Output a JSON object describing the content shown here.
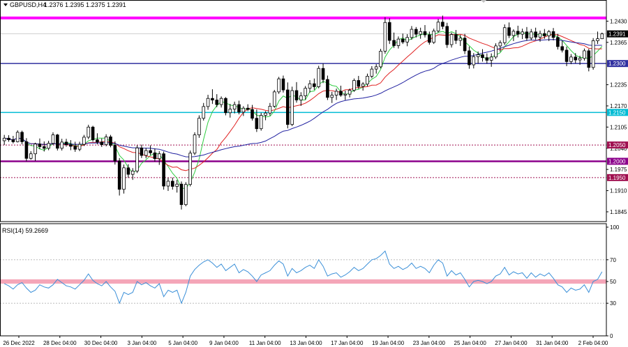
{
  "header": {
    "symbol": "GBPUSD,H4",
    "ohlc": "1.2376 1.2395 1.2375 1.2391",
    "rsi_label": "RSI(14) 59.2669"
  },
  "colors": {
    "bull": "#000000",
    "bear": "#000000",
    "ma_fast": "#2ecc40",
    "ma_mid": "#e02020",
    "ma_slow": "#2020a0",
    "rsi_line": "#3a8fd8",
    "rsi_band": "#f4a6b8"
  },
  "chart_data": [
    {
      "type": "candlestick",
      "ylim": [
        1.1815,
        1.2465
      ],
      "y_ticks": [
        "1.2430",
        "1.2365",
        "1.2235",
        "1.2170",
        "1.2105",
        "1.2040",
        "1.1975",
        "1.1910",
        "1.1845"
      ],
      "x_labels": [
        "26 Dec 2022",
        "28 Dec 04:00",
        "30 Dec 04:00",
        "3 Jan 04:00",
        "5 Jan 04:00",
        "9 Jan 04:00",
        "11 Jan 04:00",
        "13 Jan 04:00",
        "17 Jan 04:00",
        "19 Jan 04:00",
        "23 Jan 04:00",
        "25 Jan 04:00",
        "27 Jan 04:00",
        "31 Jan 04:00",
        "2 Feb 04:00"
      ],
      "current_price": {
        "value": 1.2391,
        "label": "1.2391"
      },
      "levels": [
        {
          "value": 1.244,
          "label": "",
          "color": "#ff00ff",
          "style": "solid",
          "width": 4
        },
        {
          "value": 1.23,
          "label": "1.2300",
          "color": "#3030a0",
          "style": "solid",
          "width": 1.5
        },
        {
          "value": 1.215,
          "label": "1.2150",
          "color": "#00bcd4",
          "style": "solid",
          "width": 1.5
        },
        {
          "value": 1.205,
          "label": "1.2050",
          "color": "#a01050",
          "style": "dotted",
          "width": 1
        },
        {
          "value": 1.2,
          "label": "1.2000",
          "color": "#8b008b",
          "style": "solid",
          "width": 2.5
        },
        {
          "value": 1.195,
          "label": "1.1950",
          "color": "#a01050",
          "style": "dotted",
          "width": 1
        }
      ],
      "candles": [
        [
          1.2063,
          1.2081,
          1.205,
          1.2071
        ],
        [
          1.2071,
          1.208,
          1.206,
          1.2066
        ],
        [
          1.2066,
          1.2078,
          1.2055,
          1.206
        ],
        [
          1.206,
          1.2095,
          1.2058,
          1.2089
        ],
        [
          1.2089,
          1.2094,
          1.2052,
          1.206
        ],
        [
          1.206,
          1.2071,
          1.2,
          1.2009
        ],
        [
          1.2009,
          1.2031,
          1.2005,
          1.2023
        ],
        [
          1.2023,
          1.2057,
          1.2001,
          1.2053
        ],
        [
          1.2053,
          1.207,
          1.2037,
          1.2045
        ],
        [
          1.2045,
          1.2061,
          1.203,
          1.204
        ],
        [
          1.204,
          1.2063,
          1.2034,
          1.2055
        ],
        [
          1.2055,
          1.2089,
          1.205,
          1.2081
        ],
        [
          1.2081,
          1.2084,
          1.2033,
          1.204
        ],
        [
          1.204,
          1.2069,
          1.2033,
          1.2059
        ],
        [
          1.2059,
          1.2069,
          1.2045,
          1.2051
        ],
        [
          1.2051,
          1.2065,
          1.2034,
          1.2046
        ],
        [
          1.2046,
          1.206,
          1.2029,
          1.2037
        ],
        [
          1.2037,
          1.206,
          1.2031,
          1.2052
        ],
        [
          1.2052,
          1.2081,
          1.2047,
          1.2074
        ],
        [
          1.2074,
          1.2112,
          1.2068,
          1.2105
        ],
        [
          1.2105,
          1.2109,
          1.206,
          1.2066
        ],
        [
          1.2066,
          1.2086,
          1.2052,
          1.2059
        ],
        [
          1.2059,
          1.207,
          1.2044,
          1.2051
        ],
        [
          1.2051,
          1.2083,
          1.2046,
          1.2075
        ],
        [
          1.2075,
          1.2081,
          1.2043,
          1.2049
        ],
        [
          1.2049,
          1.2061,
          1.199,
          1.2001
        ],
        [
          1.2001,
          1.201,
          1.1895,
          1.1914
        ],
        [
          1.1914,
          1.199,
          1.1901,
          1.198
        ],
        [
          1.198,
          1.1991,
          1.1949,
          1.196
        ],
        [
          1.196,
          1.1979,
          1.1943,
          1.197
        ],
        [
          1.197,
          1.2049,
          1.1964,
          1.2041
        ],
        [
          1.2041,
          1.2051,
          1.201,
          1.2018
        ],
        [
          1.2018,
          1.2041,
          1.2009,
          1.2033
        ],
        [
          1.2033,
          1.2049,
          1.2019,
          1.2026
        ],
        [
          1.2026,
          1.2039,
          1.1999,
          1.2008
        ],
        [
          1.2008,
          1.2031,
          1.1989,
          1.2023
        ],
        [
          1.2023,
          1.203,
          1.1913,
          1.1924
        ],
        [
          1.1924,
          1.1949,
          1.1909,
          1.1939
        ],
        [
          1.1939,
          1.195,
          1.1913,
          1.1923
        ],
        [
          1.1923,
          1.1943,
          1.1904,
          1.193
        ],
        [
          1.193,
          1.1938,
          1.1852,
          1.1867
        ],
        [
          1.1867,
          1.1936,
          1.1862,
          1.1929
        ],
        [
          1.1929,
          1.2033,
          1.1923,
          1.2025
        ],
        [
          1.2025,
          1.2089,
          1.2019,
          1.2081
        ],
        [
          1.2081,
          1.2141,
          1.2072,
          1.2132
        ],
        [
          1.2132,
          1.2179,
          1.2125,
          1.2168
        ],
        [
          1.2168,
          1.2204,
          1.2158,
          1.2193
        ],
        [
          1.2193,
          1.2221,
          1.2176,
          1.2188
        ],
        [
          1.2188,
          1.2206,
          1.2166,
          1.2174
        ],
        [
          1.2174,
          1.2199,
          1.2165,
          1.2193
        ],
        [
          1.2193,
          1.2197,
          1.2141,
          1.2149
        ],
        [
          1.2149,
          1.2176,
          1.2134,
          1.216
        ],
        [
          1.216,
          1.2183,
          1.2147,
          1.2174
        ],
        [
          1.2174,
          1.2186,
          1.2144,
          1.2151
        ],
        [
          1.2151,
          1.2169,
          1.2139,
          1.2163
        ],
        [
          1.2163,
          1.2175,
          1.2154,
          1.2159
        ],
        [
          1.2159,
          1.2173,
          1.2125,
          1.2132
        ],
        [
          1.2132,
          1.2159,
          1.209,
          1.21
        ],
        [
          1.21,
          1.2149,
          1.2094,
          1.2141
        ],
        [
          1.2141,
          1.2154,
          1.2126,
          1.2148
        ],
        [
          1.2148,
          1.2179,
          1.214,
          1.2169
        ],
        [
          1.2169,
          1.2219,
          1.2164,
          1.2213
        ],
        [
          1.2213,
          1.2259,
          1.2207,
          1.2253
        ],
        [
          1.2253,
          1.2263,
          1.2211,
          1.2219
        ],
        [
          1.2219,
          1.2242,
          1.2101,
          1.2113
        ],
        [
          1.2113,
          1.2229,
          1.2108,
          1.2217
        ],
        [
          1.2217,
          1.2243,
          1.218,
          1.2188
        ],
        [
          1.2188,
          1.2212,
          1.217,
          1.2201
        ],
        [
          1.2201,
          1.2231,
          1.2189,
          1.2224
        ],
        [
          1.2224,
          1.2249,
          1.2211,
          1.2238
        ],
        [
          1.2238,
          1.2254,
          1.2219,
          1.2229
        ],
        [
          1.2229,
          1.2293,
          1.2224,
          1.2285
        ],
        [
          1.2285,
          1.23,
          1.224,
          1.2251
        ],
        [
          1.2251,
          1.2263,
          1.2188,
          1.2196
        ],
        [
          1.2196,
          1.2213,
          1.2179,
          1.2203
        ],
        [
          1.2203,
          1.2223,
          1.2188,
          1.2215
        ],
        [
          1.2215,
          1.2232,
          1.2198,
          1.2203
        ],
        [
          1.2203,
          1.2217,
          1.2188,
          1.2206
        ],
        [
          1.2206,
          1.2223,
          1.2196,
          1.2218
        ],
        [
          1.2218,
          1.2254,
          1.2213,
          1.2248
        ],
        [
          1.2248,
          1.2262,
          1.2222,
          1.223
        ],
        [
          1.223,
          1.2243,
          1.2217,
          1.2237
        ],
        [
          1.2237,
          1.2269,
          1.223,
          1.2261
        ],
        [
          1.2261,
          1.2292,
          1.2255,
          1.2283
        ],
        [
          1.2283,
          1.2298,
          1.2269,
          1.229
        ],
        [
          1.229,
          1.2345,
          1.2285,
          1.2338
        ],
        [
          1.2338,
          1.2442,
          1.233,
          1.2426
        ],
        [
          1.2426,
          1.2439,
          1.236,
          1.2371
        ],
        [
          1.2371,
          1.2395,
          1.2348,
          1.2355
        ],
        [
          1.2355,
          1.2383,
          1.2346,
          1.2375
        ],
        [
          1.2375,
          1.2392,
          1.236,
          1.2366
        ],
        [
          1.2366,
          1.239,
          1.2353,
          1.238
        ],
        [
          1.238,
          1.2415,
          1.2373,
          1.2405
        ],
        [
          1.2405,
          1.2412,
          1.238,
          1.239
        ],
        [
          1.239,
          1.241,
          1.2376,
          1.2398
        ],
        [
          1.2398,
          1.2418,
          1.238,
          1.2388
        ],
        [
          1.2388,
          1.2398,
          1.2358,
          1.2365
        ],
        [
          1.2365,
          1.2407,
          1.236,
          1.24
        ],
        [
          1.24,
          1.2437,
          1.2395,
          1.2427
        ],
        [
          1.2427,
          1.2447,
          1.2405,
          1.2414
        ],
        [
          1.2414,
          1.2425,
          1.2348,
          1.2358
        ],
        [
          1.2358,
          1.2395,
          1.2349,
          1.2389
        ],
        [
          1.2389,
          1.2403,
          1.236,
          1.2371
        ],
        [
          1.2371,
          1.2388,
          1.2354,
          1.2378
        ],
        [
          1.2378,
          1.2391,
          1.2329,
          1.2339
        ],
        [
          1.2339,
          1.2352,
          1.2284,
          1.2296
        ],
        [
          1.2296,
          1.2332,
          1.2285,
          1.2321
        ],
        [
          1.2321,
          1.2337,
          1.23,
          1.2327
        ],
        [
          1.2327,
          1.2344,
          1.2306,
          1.2318
        ],
        [
          1.2318,
          1.2331,
          1.23,
          1.231
        ],
        [
          1.231,
          1.2331,
          1.229,
          1.232
        ],
        [
          1.232,
          1.2362,
          1.2314,
          1.2354
        ],
        [
          1.2354,
          1.2371,
          1.2336,
          1.2364
        ],
        [
          1.2364,
          1.242,
          1.2357,
          1.241
        ],
        [
          1.241,
          1.2426,
          1.2378,
          1.2386
        ],
        [
          1.2386,
          1.2405,
          1.2369,
          1.2399
        ],
        [
          1.2399,
          1.2416,
          1.238,
          1.239
        ],
        [
          1.239,
          1.2407,
          1.2375,
          1.2397
        ],
        [
          1.2397,
          1.2412,
          1.237,
          1.2378
        ],
        [
          1.2378,
          1.2406,
          1.2371,
          1.2397
        ],
        [
          1.2397,
          1.241,
          1.2373,
          1.2381
        ],
        [
          1.2381,
          1.2401,
          1.2367,
          1.2392
        ],
        [
          1.2392,
          1.2406,
          1.2376,
          1.2385
        ],
        [
          1.2385,
          1.2403,
          1.2369,
          1.2398
        ],
        [
          1.2398,
          1.2409,
          1.2371,
          1.238
        ],
        [
          1.238,
          1.2391,
          1.2343,
          1.2352
        ],
        [
          1.2352,
          1.237,
          1.2334,
          1.2341
        ],
        [
          1.2341,
          1.2352,
          1.2292,
          1.2306
        ],
        [
          1.2306,
          1.2329,
          1.2298,
          1.232
        ],
        [
          1.232,
          1.2332,
          1.2301,
          1.2311
        ],
        [
          1.2311,
          1.2324,
          1.2296,
          1.2316
        ],
        [
          1.2316,
          1.2346,
          1.2309,
          1.2339
        ],
        [
          1.2339,
          1.2345,
          1.2276,
          1.2288
        ],
        [
          1.2288,
          1.2378,
          1.2281,
          1.237
        ],
        [
          1.237,
          1.2398,
          1.236,
          1.2376
        ],
        [
          1.2376,
          1.2395,
          1.2375,
          1.2391
        ]
      ],
      "moving_averages": [
        {
          "name": "",
          "color": "#2ecc40",
          "period": 5
        },
        {
          "name": "",
          "color": "#e02020",
          "period": 13
        },
        {
          "name": "",
          "color": "#2020a0",
          "period": 34
        }
      ]
    },
    {
      "type": "line",
      "ylim": [
        0,
        100
      ],
      "y_ticks": [
        "100",
        "70",
        "50",
        "30",
        "0"
      ],
      "band": [
        48,
        52
      ],
      "dotted_levels": [
        70,
        30
      ],
      "values": [
        48,
        46,
        43,
        47,
        49,
        44,
        40,
        42,
        47,
        45,
        44,
        47,
        52,
        49,
        46,
        45,
        43,
        47,
        51,
        57,
        51,
        48,
        46,
        50,
        45,
        41,
        30,
        40,
        38,
        40,
        50,
        47,
        49,
        46,
        44,
        48,
        36,
        42,
        40,
        42,
        30,
        40,
        55,
        61,
        65,
        68,
        70,
        67,
        63,
        66,
        60,
        63,
        66,
        58,
        61,
        59,
        55,
        50,
        56,
        58,
        60,
        65,
        69,
        66,
        55,
        62,
        58,
        60,
        63,
        65,
        62,
        70,
        64,
        55,
        57,
        58,
        54,
        56,
        59,
        63,
        60,
        62,
        66,
        70,
        71,
        74,
        78,
        66,
        62,
        64,
        61,
        63,
        67,
        62,
        64,
        62,
        58,
        65,
        70,
        67,
        55,
        60,
        56,
        58,
        52,
        45,
        50,
        51,
        50,
        48,
        50,
        55,
        57,
        63,
        56,
        59,
        57,
        58,
        53,
        58,
        54,
        57,
        55,
        58,
        53,
        47,
        45,
        40,
        44,
        42,
        43,
        47,
        40,
        50,
        52,
        59
      ]
    }
  ]
}
